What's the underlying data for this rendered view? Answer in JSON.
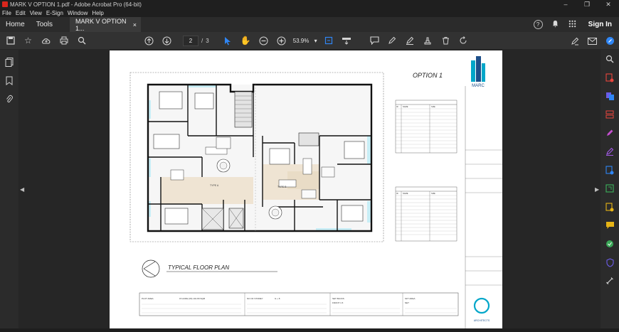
{
  "window": {
    "title": "MARK V OPTION 1.pdf - Adobe Acrobat Pro (64-bit)",
    "controls": [
      "–",
      "❐",
      "✕"
    ]
  },
  "menu": [
    "File",
    "Edit",
    "View",
    "E-Sign",
    "Window",
    "Help"
  ],
  "tabs": {
    "home": "Home",
    "tools": "Tools",
    "document": "MARK V OPTION 1...",
    "close": "×"
  },
  "header_right": {
    "help": "?",
    "bell": "🔔",
    "apps": "⋮⋮",
    "sign_in": "Sign In"
  },
  "toolbar": {
    "current_page": "2",
    "page_sep": "/",
    "total_pages": "3",
    "zoom": "53.9%",
    "zoom_caret": "▾"
  },
  "drawing": {
    "option_title": "OPTION 1",
    "firm_name": "MARC",
    "plan_title": "TYPICAL FLOOR PLAN",
    "type_labels": [
      "TYPE A",
      "TYPE B"
    ],
    "architects_label": "ARCHITECTS",
    "table_a_header": [
      "ID",
      "NAME",
      "SIZE"
    ],
    "table_b_header": [
      "ID",
      "NAME",
      "SIZE"
    ],
    "summary_labels": [
      "PLOT AREA",
      "NO OF STOREY",
      "SET BACKS",
      "SFT AREA"
    ],
    "summary_values": [
      "15  ACRE (06) 101.80 SQM",
      "G + 8",
      "FRONT  1.5",
      "NET"
    ]
  },
  "colors": {
    "accent": "#2f86f5",
    "brand": "#00a6c9",
    "pdf_red": "#d9261c"
  }
}
